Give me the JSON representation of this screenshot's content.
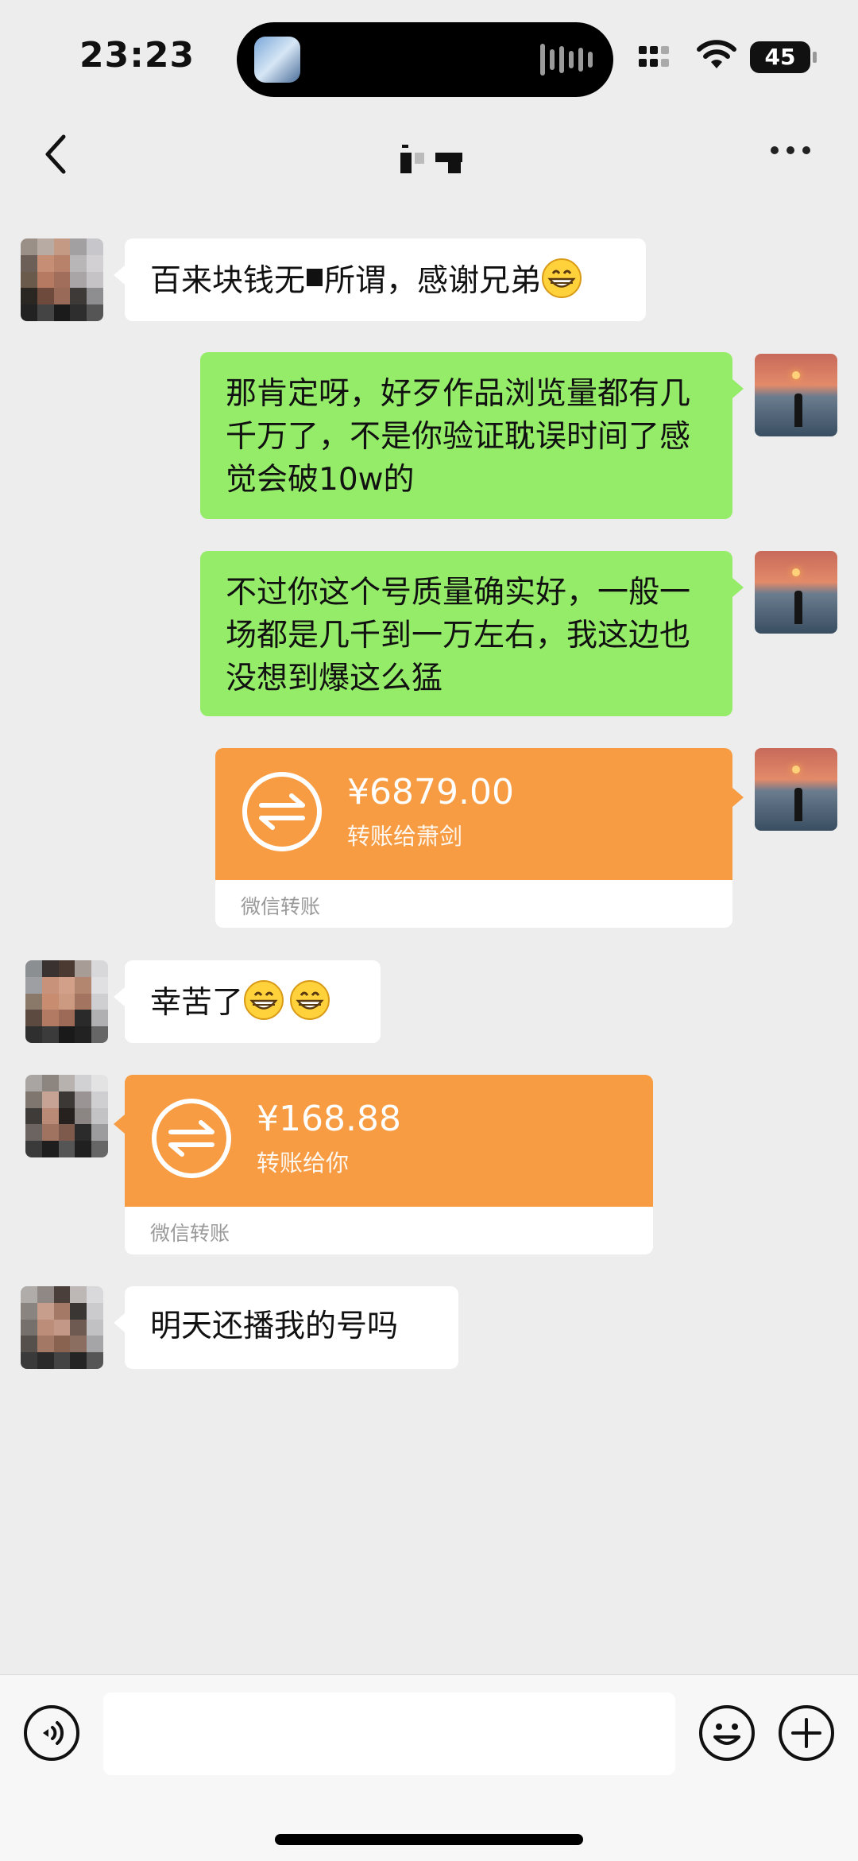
{
  "status_bar": {
    "time": "23:23",
    "battery": "45"
  },
  "header": {
    "back_icon": "chevron-left-icon",
    "more_icon": "more-dots-icon"
  },
  "messages": [
    {
      "side": "in",
      "type": "text",
      "text_before": "百来块钱无",
      "text_after": "所谓，感谢兄弟",
      "emoji": "grin-emoji"
    },
    {
      "side": "out",
      "type": "text",
      "text": "那肯定呀，好歹作品浏览量都有几千万了，不是你验证耽误时间了感觉会破10w的"
    },
    {
      "side": "out",
      "type": "text",
      "text": "不过你这个号质量确实好，一般一场都是几千到一万左右，我这边也没想到爆这么猛"
    },
    {
      "side": "out",
      "type": "transfer",
      "amount": "¥6879.00",
      "label": "转账给萧剑",
      "footer": "微信转账"
    },
    {
      "side": "in",
      "type": "text",
      "text": "幸苦了",
      "emoji_count": 2
    },
    {
      "side": "in",
      "type": "transfer",
      "amount": "¥168.88",
      "label": "转账给你",
      "footer": "微信转账"
    },
    {
      "side": "in",
      "type": "text",
      "text": "明天还播我的号吗"
    }
  ],
  "input_bar": {
    "voice_icon": "voice-icon",
    "emoji_icon": "smiley-icon",
    "plus_icon": "plus-icon",
    "message_value": ""
  },
  "colors": {
    "background": "#ededed",
    "bubble_out": "#95ec69",
    "bubble_in": "#ffffff",
    "transfer": "#f79c42"
  }
}
